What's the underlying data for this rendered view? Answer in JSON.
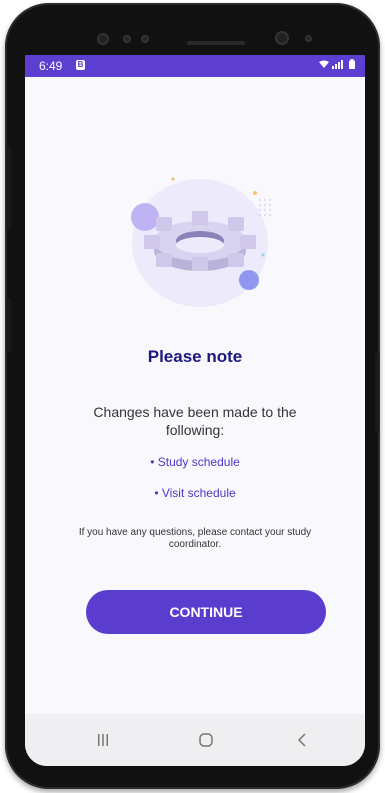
{
  "status_bar": {
    "time": "6:49",
    "b_badge": "B"
  },
  "dialog": {
    "title": "Please note",
    "message": "Changes have been made to the following:",
    "changes": [
      "• Study schedule",
      "• Visit schedule"
    ],
    "help_text": "If you have any questions, please contact your study coordinator.",
    "continue_label": "CONTINUE"
  },
  "colors": {
    "accent": "#5a3dcf",
    "title": "#1c1880",
    "status_bar": "#5c3ed1"
  },
  "icons": [
    "gear-illustration",
    "wifi-icon",
    "signal-icon",
    "battery-icon",
    "recents-icon",
    "home-icon",
    "back-icon"
  ]
}
